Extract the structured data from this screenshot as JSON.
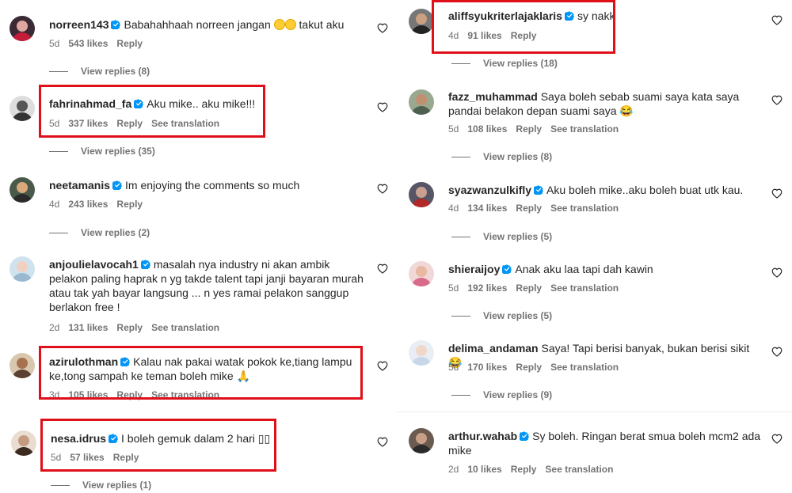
{
  "labels": {
    "reply": "Reply",
    "see_translation": "See translation"
  },
  "left": [
    {
      "user": "norreen143",
      "text": "Babahahhaah norreen jangan",
      "emoji_after": "😂😂",
      "text2": " takut aku",
      "time": "5d",
      "likes": "543 likes",
      "replies": "View replies (8)"
    },
    {
      "user": "fahrinahmad_fa",
      "text": "Aku mike.. aku mike!!!",
      "time": "5d",
      "likes": "337 likes",
      "replies": "View replies (35)"
    },
    {
      "user": "neetamanis",
      "text": "Im enjoying the comments so much",
      "time": "4d",
      "likes": "243 likes",
      "replies": "View replies (2)"
    },
    {
      "user": "anjoulielavocah1",
      "text": "masalah nya industry ni akan ambik pelakon paling haprak n yg takde talent tapi janji bayaran murah atau tak yah bayar langsung ... n yes ramai pelakon sanggup berlakon free !",
      "time": "2d",
      "likes": "131 likes"
    },
    {
      "user": "azirulothman",
      "text": "Kalau nak pakai watak pokok ke,tiang lampu ke,tong sampah ke teman boleh mike 🙏",
      "time": "3d",
      "likes": "105 likes"
    },
    {
      "user": "nesa.idrus",
      "text": "I boleh gemuk dalam 2 hari ▯▯",
      "time": "5d",
      "likes": "57 likes",
      "replies": "View replies (1)"
    }
  ],
  "right": [
    {
      "user": "aliffsyukriterlajaklaris",
      "text": "sy nakk",
      "time": "4d",
      "likes": "91 likes",
      "replies": "View replies (18)"
    },
    {
      "user": "fazz_muhammad",
      "text": "Saya boleh sebab suami saya kata saya pandai belakon depan suami saya 😂",
      "time": "5d",
      "likes": "108 likes",
      "replies": "View replies (8)"
    },
    {
      "user": "syazwanzulkifly",
      "text": "Aku boleh mike..aku boleh buat utk kau.",
      "time": "4d",
      "likes": "134 likes",
      "replies": "View replies (5)"
    },
    {
      "user": "shieraijoy",
      "text": "Anak aku laa tapi dah kawin",
      "time": "5d",
      "likes": "192 likes",
      "replies": "View replies (5)"
    },
    {
      "user": "delima_andaman",
      "text": "Saya! Tapi berisi banyak, bukan berisi sikit 😂",
      "time": "5d",
      "likes": "170 likes",
      "replies": "View replies (9)"
    },
    {
      "user": "arthur.wahab",
      "text": "Sy boleh. Ringan berat smua boleh mcm2 ada mike",
      "time": "2d",
      "likes": "10 likes"
    }
  ],
  "colors": {
    "highlight": "#e0101a",
    "verified": "#0095f6",
    "meta": "#737373"
  }
}
